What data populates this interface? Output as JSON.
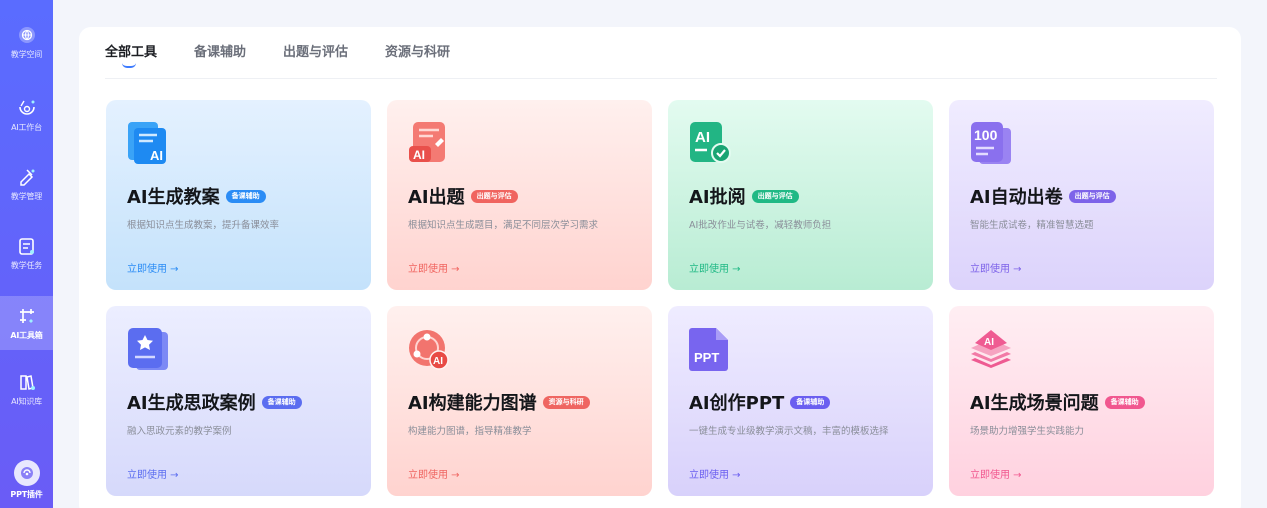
{
  "sidebar": {
    "items": [
      {
        "label": "教学空间",
        "icon": "globe-icon"
      },
      {
        "label": "AI工作台",
        "icon": "workbench-icon"
      },
      {
        "label": "教学管理",
        "icon": "management-icon"
      },
      {
        "label": "教学任务",
        "icon": "task-icon"
      },
      {
        "label": "AI工具箱",
        "icon": "toolbox-icon",
        "active": true
      },
      {
        "label": "AI知识库",
        "icon": "knowledge-icon"
      },
      {
        "label": "PPT插件",
        "icon": "ppt-plugin-icon"
      }
    ]
  },
  "tabs": [
    {
      "label": "全部工具",
      "active": true
    },
    {
      "label": "备课辅助"
    },
    {
      "label": "出题与评估"
    },
    {
      "label": "资源与科研"
    }
  ],
  "cards": [
    {
      "title": "AI生成教案",
      "badge": "备课辅助",
      "desc": "根据知识点生成教案，提升备课效率",
      "link": "立即使用 →",
      "icon": "lesson-plan-icon",
      "icon_text": "AI",
      "color": "#2b8cf5"
    },
    {
      "title": "AI出题",
      "badge": "出题与评估",
      "desc": "根据知识点生成题目，满足不同层次学习需求",
      "link": "立即使用 →",
      "icon": "question-gen-icon",
      "icon_text": "AI",
      "color": "#f0645f"
    },
    {
      "title": "AI批阅",
      "badge": "出题与评估",
      "desc": "AI批改作业与试卷，减轻教师负担",
      "link": "立即使用 →",
      "icon": "grading-icon",
      "icon_text": "AI",
      "color": "#20b985"
    },
    {
      "title": "AI自动出卷",
      "badge": "出题与评估",
      "desc": "智能生成试卷，精准智慧选题",
      "link": "立即使用 →",
      "icon": "exam-paper-icon",
      "icon_text": "100",
      "color": "#7d63e9"
    },
    {
      "title": "AI生成思政案例",
      "badge": "备课辅助",
      "desc": "融入思政元素的教学案例",
      "link": "立即使用 →",
      "icon": "ideology-case-icon",
      "icon_text": "",
      "color": "#5b6df0"
    },
    {
      "title": "AI构建能力图谱",
      "badge": "资源与科研",
      "desc": "构建能力图谱，指导精准教学",
      "link": "立即使用 →",
      "icon": "ability-map-icon",
      "icon_text": "AI",
      "color": "#ef6561"
    },
    {
      "title": "AI创作PPT",
      "badge": "备课辅助",
      "desc": "一键生成专业级教学演示文稿，丰富的模板选择",
      "link": "立即使用 →",
      "icon": "ppt-create-icon",
      "icon_text": "PPT",
      "color": "#6a5ef0"
    },
    {
      "title": "AI生成场景问题",
      "badge": "备课辅助",
      "desc": "场景助力增强学生实践能力",
      "link": "立即使用 →",
      "icon": "scenario-icon",
      "icon_text": "AI",
      "color": "#f1578f"
    }
  ]
}
